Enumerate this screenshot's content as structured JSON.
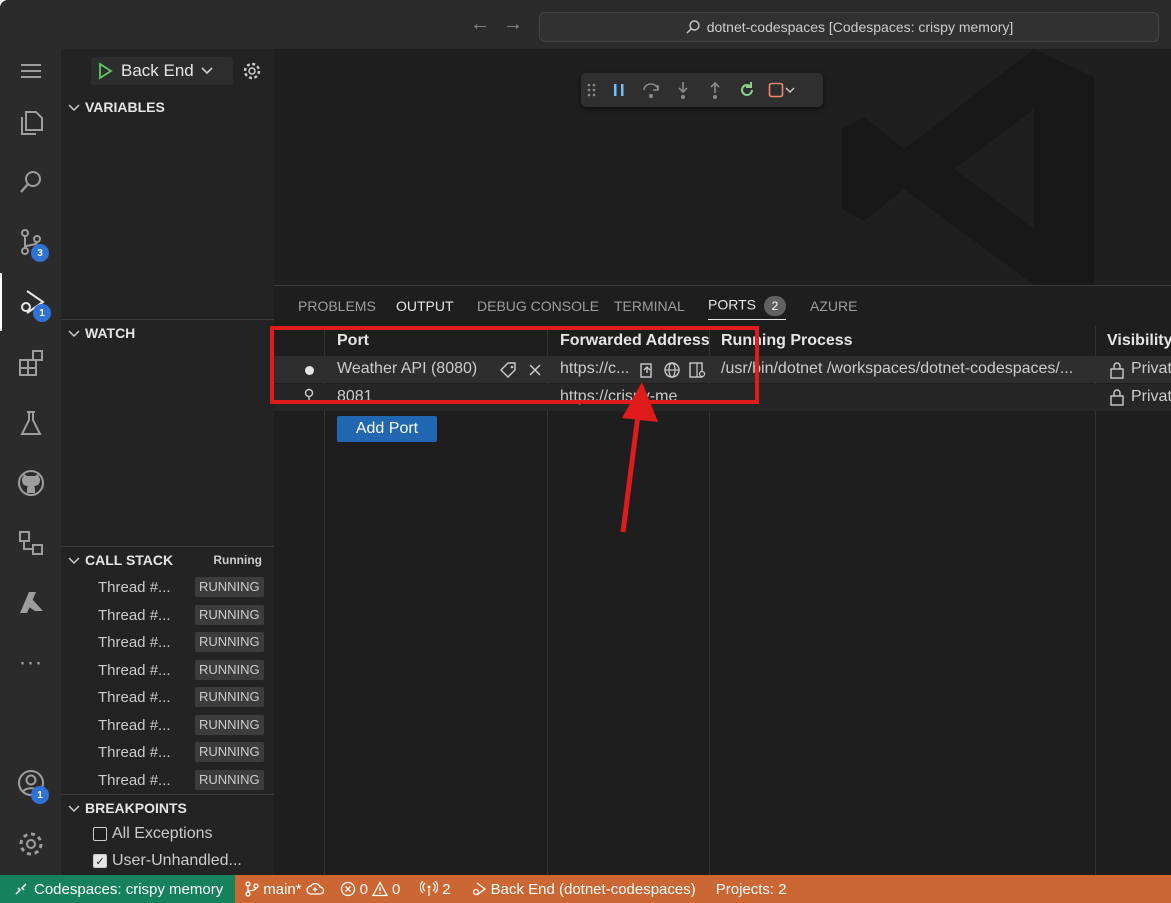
{
  "titlebar": {
    "command_center": "dotnet-codespaces [Codespaces: crispy memory]",
    "back_arrow": "←",
    "forward_arrow": "→"
  },
  "activity_bar": {
    "source_control_badge": "3",
    "run_debug_badge": "1",
    "accounts_badge": "1"
  },
  "sidebar": {
    "debug_config": "Back End",
    "variables_title": "VARIABLES",
    "watch_title": "WATCH",
    "call_stack_title": "CALL STACK",
    "call_stack_state": "Running",
    "threads": [
      {
        "name": "Thread #...",
        "status": "RUNNING"
      },
      {
        "name": "Thread #...",
        "status": "RUNNING"
      },
      {
        "name": "Thread #...",
        "status": "RUNNING"
      },
      {
        "name": "Thread #...",
        "status": "RUNNING"
      },
      {
        "name": "Thread #...",
        "status": "RUNNING"
      },
      {
        "name": "Thread #...",
        "status": "RUNNING"
      },
      {
        "name": "Thread #...",
        "status": "RUNNING"
      },
      {
        "name": "Thread #...",
        "status": "RUNNING"
      }
    ],
    "breakpoints_title": "BREAKPOINTS",
    "breakpoints": [
      {
        "label": "All Exceptions",
        "checked": false
      },
      {
        "label": "User-Unhandled...",
        "checked": true
      }
    ]
  },
  "panel": {
    "tabs": [
      "PROBLEMS",
      "OUTPUT",
      "DEBUG CONSOLE",
      "TERMINAL",
      "PORTS",
      "AZURE"
    ],
    "ports_count": "2",
    "columns": [
      "Port",
      "Forwarded Address",
      "Running Process",
      "Visibility"
    ],
    "rows": [
      {
        "port": "Weather API (8080)",
        "address": "https://c...",
        "process": "/usr/bin/dotnet /workspaces/dotnet-codespaces/...",
        "visibility": "Privat"
      },
      {
        "port": "8081",
        "address": "https://crispy-me",
        "process": "",
        "visibility": "Privat"
      }
    ],
    "add_port_label": "Add Port"
  },
  "status_bar": {
    "remote": "Codespaces: crispy memory",
    "branch": "main*",
    "errors": "0",
    "warnings": "0",
    "ports": "2",
    "debug_target": "Back End (dotnet-codespaces)",
    "projects": "Projects: 2"
  },
  "colors": {
    "accent": "#2f73d6",
    "status_bar": "#cc6633",
    "remote": "#16825d",
    "annotation": "#e01b1b"
  }
}
